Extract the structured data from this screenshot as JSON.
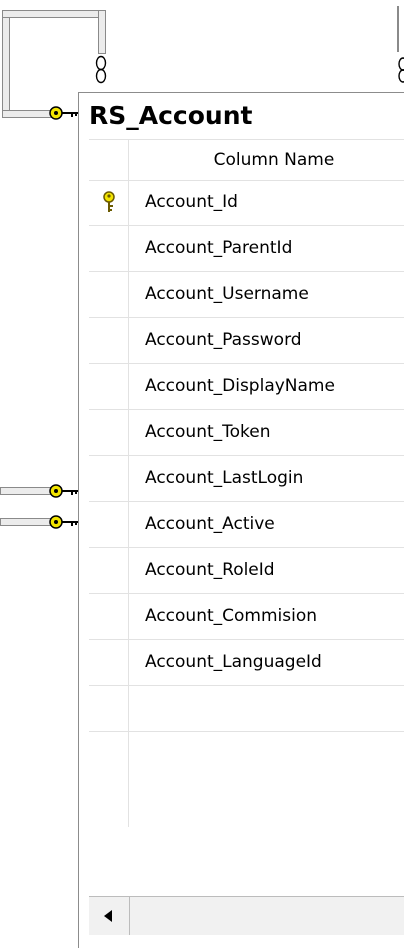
{
  "table": {
    "name": "RS_Account",
    "column_header": "Column Name",
    "columns": [
      {
        "name": "Account_Id",
        "primary_key": true
      },
      {
        "name": "Account_ParentId",
        "primary_key": false
      },
      {
        "name": "Account_Username",
        "primary_key": false
      },
      {
        "name": "Account_Password",
        "primary_key": false
      },
      {
        "name": "Account_DisplayName",
        "primary_key": false
      },
      {
        "name": "Account_Token",
        "primary_key": false
      },
      {
        "name": "Account_LastLogin",
        "primary_key": false
      },
      {
        "name": "Account_Active",
        "primary_key": false
      },
      {
        "name": "Account_RoleId",
        "primary_key": false
      },
      {
        "name": "Account_Commision",
        "primary_key": false
      },
      {
        "name": "Account_LanguageId",
        "primary_key": false
      },
      {
        "name": "",
        "primary_key": false
      }
    ]
  },
  "icons": {
    "primary_key": "key-icon",
    "relationship_end": "key-icon",
    "relationship_many": "infinity-icon",
    "scroll_left": "arrow-left-icon"
  },
  "colors": {
    "key_yellow": "#f2e400",
    "grid_line": "#e2e2e2",
    "connector_gray": "#8a8a8a"
  }
}
